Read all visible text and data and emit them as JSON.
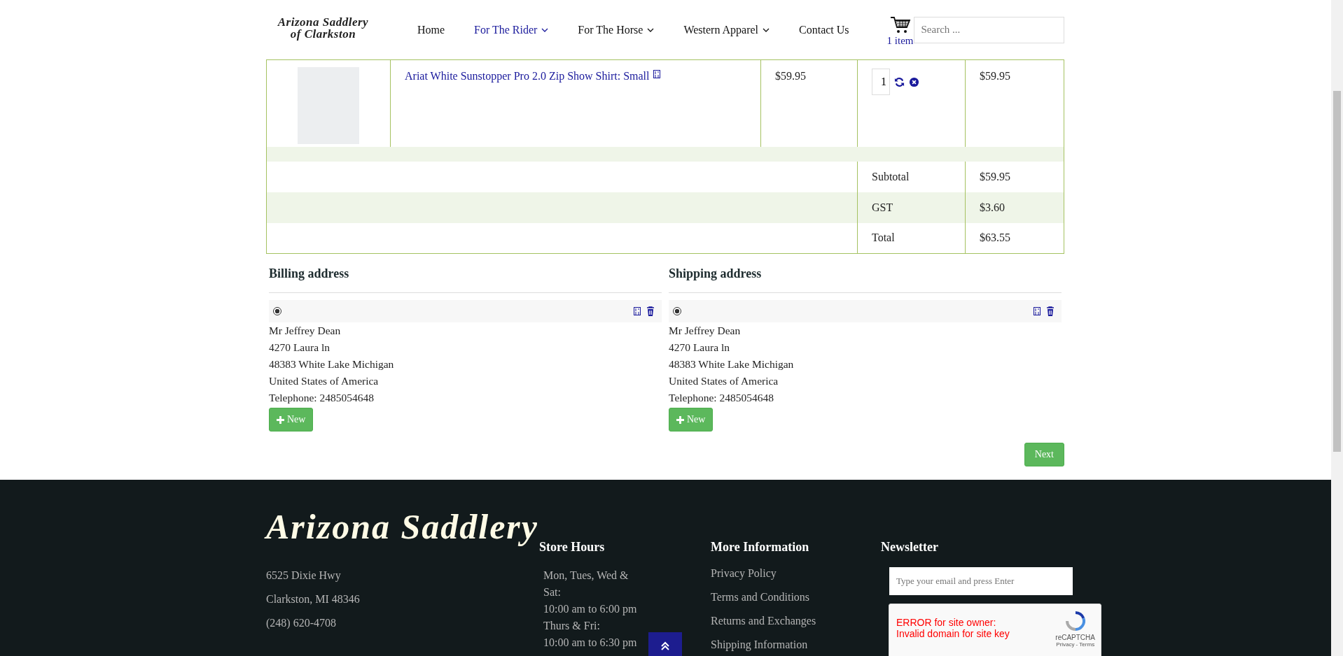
{
  "header": {
    "logo": [
      "Arizona Saddlery",
      "of Clarkston"
    ],
    "nav": [
      {
        "label": "Home",
        "selected": false,
        "dropdown": false
      },
      {
        "label": "For The Rider",
        "selected": true,
        "dropdown": true
      },
      {
        "label": "For The Horse",
        "selected": false,
        "dropdown": true
      },
      {
        "label": "Western Apparel",
        "selected": false,
        "dropdown": true
      },
      {
        "label": "Contact Us",
        "selected": false,
        "dropdown": false
      }
    ],
    "cart": {
      "count": "1 item"
    },
    "search": {
      "placeholder": "Search ..."
    }
  },
  "cart_table": {
    "items": [
      {
        "name": "Ariat White Sunstopper Pro 2.0 Zip Show Shirt: Small",
        "price": "$59.95",
        "quantity": "1",
        "total": "$59.95"
      }
    ],
    "summary": [
      {
        "label": "Subtotal",
        "value": "$59.95"
      },
      {
        "label": "GST",
        "value": "$3.60"
      },
      {
        "label": "Total",
        "value": "$63.55"
      }
    ]
  },
  "addresses": [
    {
      "title": "Billing address",
      "selected": true,
      "lines": [
        "Mr Jeffrey Dean",
        "4270 Laura ln",
        "48383 White Lake Michigan",
        "United States of America",
        "Telephone: 2485054648"
      ],
      "new_button": "New"
    },
    {
      "title": "Shipping address",
      "selected": true,
      "lines": [
        "Mr Jeffrey Dean",
        "4270 Laura ln",
        "48383 White Lake Michigan",
        "United States of America",
        "Telephone: 2485054648"
      ],
      "new_button": "New"
    }
  ],
  "next_button": "Next",
  "footer": {
    "logo": "Arizona Saddlery",
    "contact": [
      "6525 Dixie Hwy",
      "Clarkston, MI 48346",
      "(248) 620-4708"
    ],
    "store_hours": {
      "title": "Store Hours",
      "lines": [
        "Mon, Tues, Wed & Sat:",
        "10:00 am to 6:00 pm",
        "Thurs & Fri:",
        "10:00 am to 6:30 pm"
      ]
    },
    "more_information": {
      "title": "More Information",
      "links": [
        "Privacy Policy",
        "Terms and Conditions",
        "Returns and Exchanges",
        "Shipping Information"
      ]
    },
    "newsletter": {
      "title": "Newsletter",
      "placeholder": "Type your email and press Enter",
      "captcha_error": [
        "ERROR for site owner:",
        "Invalid domain for site key"
      ],
      "captcha_brand": "reCAPTCHA",
      "captcha_links": "Privacy - Terms"
    }
  }
}
